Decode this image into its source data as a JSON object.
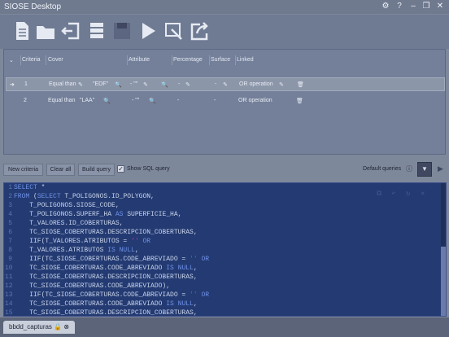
{
  "window": {
    "title": "SIOSE Desktop"
  },
  "toolbar": {
    "icons": [
      "new-document-icon",
      "open-folder-icon",
      "import-icon",
      "database-icon",
      "save-icon",
      "run-icon",
      "edit-query-icon",
      "export-icon"
    ]
  },
  "criteria": {
    "headers": {
      "criteria": "Criteria",
      "cover": "Cover",
      "attribute": "Attribute",
      "percentage": "Percentage",
      "surface": "Surface",
      "linked": "Linked"
    },
    "rows": [
      {
        "num": "1",
        "cover_op": "Equal than",
        "cover_val": "\"EDF\"",
        "attr": "- \"\"",
        "percentage": "-",
        "surface": "-",
        "linked": "OR operation"
      },
      {
        "num": "2",
        "cover_op": "Equal than",
        "cover_val": "\"LAA\"",
        "attr": "- \"\"",
        "percentage": "-",
        "surface": "-",
        "linked": "OR operation"
      }
    ]
  },
  "controls": {
    "new_criteria": "New criteria",
    "clear_all": "Clear all",
    "build_query": "Build query",
    "show_sql": "Show SQL query",
    "default_queries": "Default queries"
  },
  "sql": {
    "lines": [
      {
        "n": "1",
        "t": "SELECT *"
      },
      {
        "n": "2",
        "t": "FROM (SELECT T_POLIGONOS.ID_POLYGON,"
      },
      {
        "n": "3",
        "t": "    T_POLIGONOS.SIOSE_CODE,"
      },
      {
        "n": "4",
        "t": "    T_POLIGONOS.SUPERF_HA AS SUPERFICIE_HA,"
      },
      {
        "n": "5",
        "t": "    T_VALORES.ID_COBERTURAS,"
      },
      {
        "n": "6",
        "t": "    TC_SIOSE_COBERTURAS.DESCRIPCION_COBERTURAS,"
      },
      {
        "n": "7",
        "t": "    IIF(T_VALORES.ATRIBUTOS = '' OR"
      },
      {
        "n": "8",
        "t": "    T_VALORES.ATRIBUTOS IS NULL,"
      },
      {
        "n": "9",
        "t": "    IIF(TC_SIOSE_COBERTURAS.CODE_ABREVIADO = '' OR"
      },
      {
        "n": "10",
        "t": "    TC_SIOSE_COBERTURAS.CODE_ABREVIADO IS NULL,"
      },
      {
        "n": "11",
        "t": "    TC_SIOSE_COBERTURAS.DESCRIPCION_COBERTURAS,"
      },
      {
        "n": "12",
        "t": "    TC_SIOSE_COBERTURAS.CODE_ABREVIADO),"
      },
      {
        "n": "13",
        "t": "    IIF(TC_SIOSE_COBERTURAS.CODE_ABREVIADO = '' OR"
      },
      {
        "n": "14",
        "t": "    TC_SIOSE_COBERTURAS.CODE_ABREVIADO IS NULL,"
      },
      {
        "n": "15",
        "t": "    TC_SIOSE_COBERTURAS.DESCRIPCION_COBERTURAS,"
      }
    ]
  },
  "bottom": {
    "tab_label": "bbdd_capturas"
  }
}
